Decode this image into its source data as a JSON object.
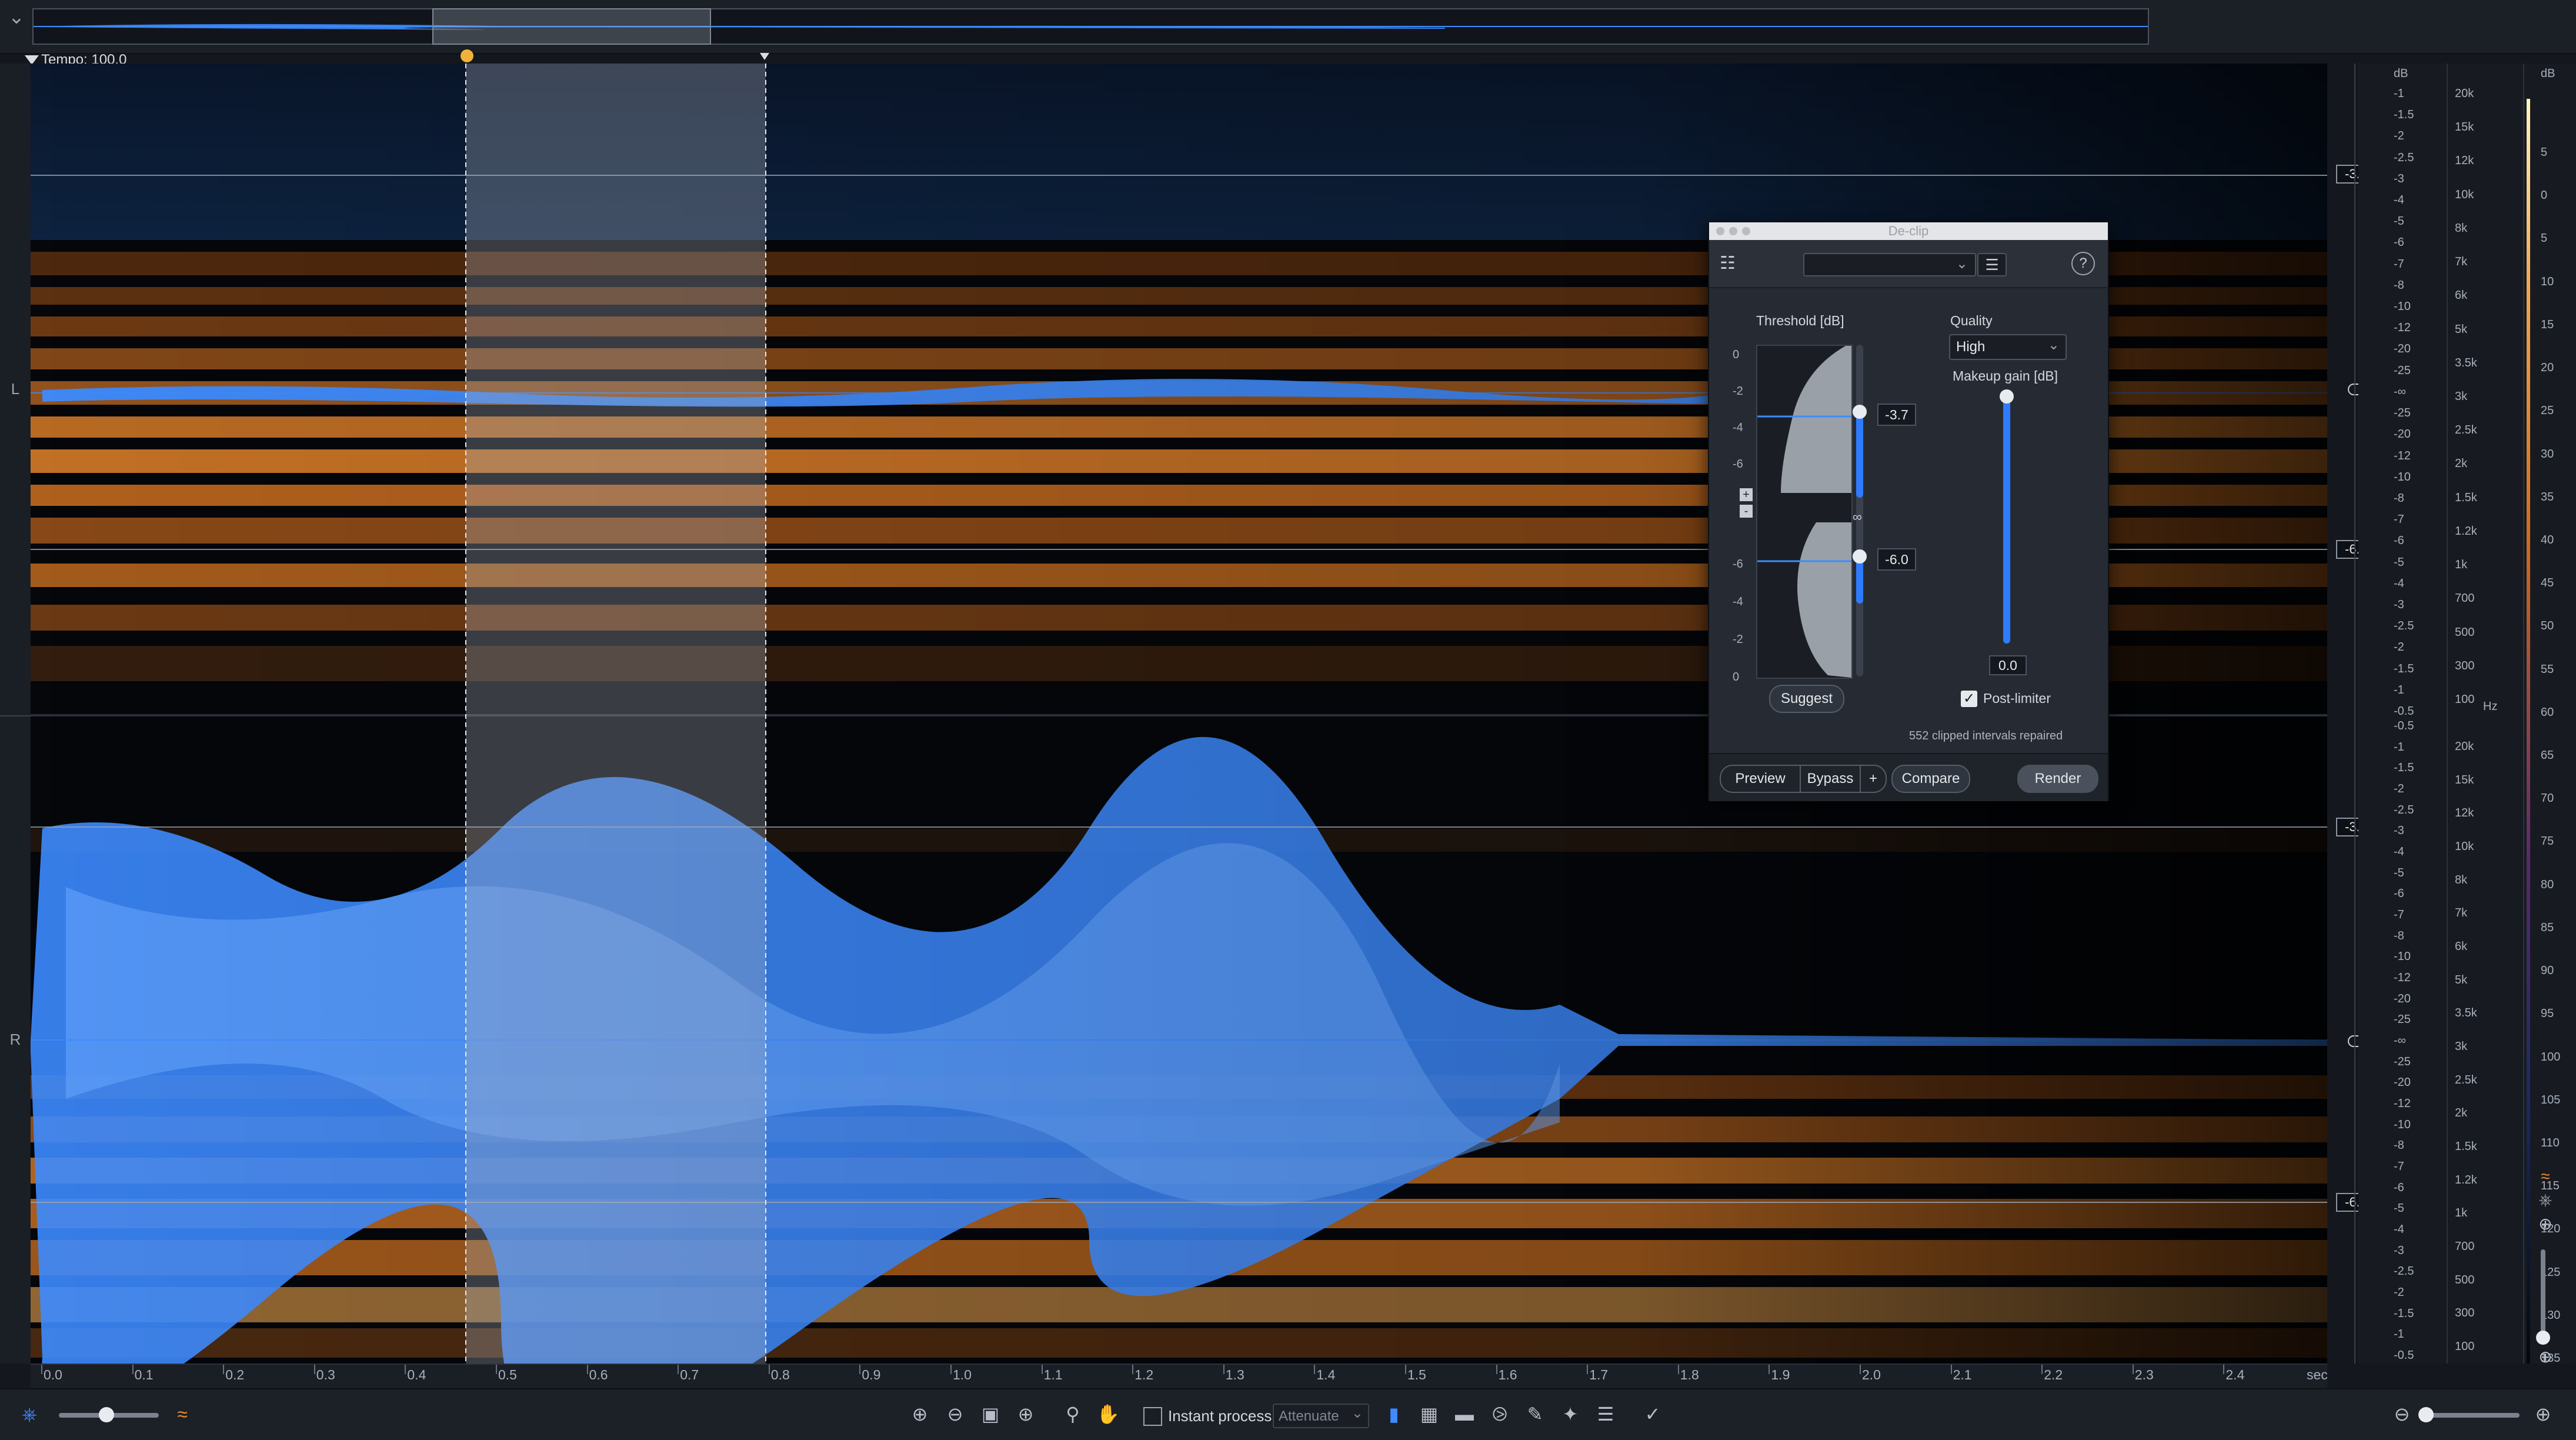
{
  "tempo_label": "Tempo: 100.0",
  "channels": {
    "left": "L",
    "right": "R"
  },
  "time_axis": {
    "labels": [
      "0.0",
      "0.1",
      "0.2",
      "0.3",
      "0.4",
      "0.5",
      "0.6",
      "0.7",
      "0.8",
      "0.9",
      "1.0",
      "1.1",
      "1.2",
      "1.3",
      "1.4",
      "1.5",
      "1.6",
      "1.7",
      "1.8",
      "1.9",
      "2.0",
      "2.1",
      "2.2",
      "2.3",
      "2.4"
    ],
    "unit": "sec"
  },
  "clip_thresholds": {
    "upper": "-3.7",
    "lower": "-6.0"
  },
  "db_scale": {
    "header": "dB",
    "top_channel": [
      "-1",
      "-1.5",
      "-2",
      "-2.5",
      "-3",
      "-4",
      "-5",
      "-6",
      "-7",
      "-8",
      "-10",
      "-12",
      "-20",
      "-25",
      "-∞",
      "-25",
      "-20",
      "-12",
      "-10",
      "-8",
      "-7",
      "-6",
      "-5",
      "-4",
      "-3",
      "-2.5",
      "-2",
      "-1.5",
      "-1",
      "-0.5"
    ],
    "bottom_channel": [
      "-0.5",
      "-1",
      "-1.5",
      "-2",
      "-2.5",
      "-3",
      "-4",
      "-5",
      "-6",
      "-7",
      "-8",
      "-10",
      "-12",
      "-20",
      "-25",
      "-∞",
      "-25",
      "-20",
      "-12",
      "-10",
      "-8",
      "-7",
      "-6",
      "-5",
      "-4",
      "-3",
      "-2.5",
      "-2",
      "-1.5",
      "-1",
      "-0.5"
    ]
  },
  "hz_scale": {
    "unit": "Hz",
    "top_channel": [
      "20k",
      "15k",
      "12k",
      "10k",
      "8k",
      "7k",
      "6k",
      "5k",
      "3.5k",
      "3k",
      "2.5k",
      "2k",
      "1.5k",
      "1.2k",
      "1k",
      "700",
      "500",
      "300",
      "100"
    ],
    "bottom_channel": [
      "20k",
      "15k",
      "12k",
      "10k",
      "8k",
      "7k",
      "6k",
      "5k",
      "3.5k",
      "3k",
      "2.5k",
      "2k",
      "1.5k",
      "1.2k",
      "1k",
      "700",
      "500",
      "300",
      "100"
    ]
  },
  "colormap_scale": {
    "header": "dB",
    "labels": [
      "5",
      "0",
      "5",
      "10",
      "15",
      "20",
      "25",
      "30",
      "35",
      "40",
      "45",
      "50",
      "55",
      "60",
      "65",
      "70",
      "75",
      "80",
      "85",
      "90",
      "95",
      "100",
      "105",
      "110",
      "115",
      "120",
      "125",
      "130",
      "135"
    ]
  },
  "declip": {
    "title": "De-clip",
    "threshold_label": "Threshold [dB]",
    "threshold_ticks_upper": [
      "0",
      "-2",
      "-4",
      "-6"
    ],
    "threshold_ticks_lower": [
      "-6",
      "-4",
      "-2",
      "0"
    ],
    "threshold_upper_value": "-3.7",
    "threshold_lower_value": "-6.0",
    "quality_label": "Quality",
    "quality_value": "High",
    "makeup_label": "Makeup gain [dB]",
    "makeup_value": "0.0",
    "makeup_fraction": 1.0,
    "post_limiter_label": "Post-limiter",
    "post_limiter_checked": true,
    "suggest_label": "Suggest",
    "status": "552 clipped intervals repaired",
    "preview": "Preview",
    "bypass": "Bypass",
    "plus": "+",
    "compare": "Compare",
    "render": "Render"
  },
  "bottom_toolbar": {
    "instant_process_label": "Instant process",
    "instant_process_checked": false,
    "mode_value": "Attenuate"
  },
  "colors": {
    "waveform": "#3d8bff",
    "spectrogram_hot": "#f08a2c",
    "selection": "#aab2bf",
    "accent": "#2f7bff",
    "selection_handle": "#f0b23a"
  }
}
